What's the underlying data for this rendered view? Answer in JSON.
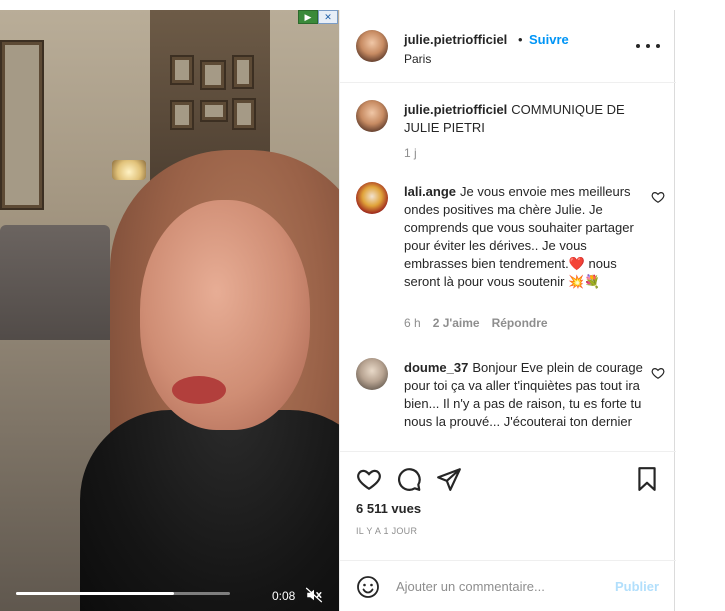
{
  "video": {
    "ad_badge": {
      "play_glyph": "▶",
      "close_glyph": "✕"
    },
    "progress_fraction": 0.74,
    "time": "0:08",
    "mute_icon": "speaker-muted-icon"
  },
  "post": {
    "author": "julie.pietriofficiel",
    "separator": "•",
    "follow_label": "Suivre",
    "location": "Paris",
    "caption": "COMMUNIQUE DE JULIE PIETRI",
    "caption_age": "1 j"
  },
  "comments": [
    {
      "username": "lali.ange",
      "text": "Je vous envoie mes meilleurs ondes positives ma chère Julie. Je comprends que vous souhaiter partager pour éviter les dérives.. Je vous embrasses bien tendrement.❤️ nous seront là pour vous soutenir 💥💐",
      "age": "6 h",
      "likes": "2 J'aime",
      "reply": "Répondre"
    },
    {
      "username": "doume_37",
      "text": "Bonjour Eve plein de courage pour toi ça va aller t'inquiètes pas tout ira bien... Il n'y a pas de raison, tu es forte tu nous la prouvé... J'écouterai ton dernier",
      "age": "",
      "likes": "",
      "reply": ""
    }
  ],
  "actions": {
    "views": "6 511 vues",
    "posted_ago": "IL Y A 1 JOUR"
  },
  "composer": {
    "placeholder": "Ajouter un commentaire...",
    "post_label": "Publier"
  },
  "colors": {
    "accent": "#0095f6",
    "post_disabled": "#b2dffc",
    "muted_text": "#8e8e8e"
  }
}
